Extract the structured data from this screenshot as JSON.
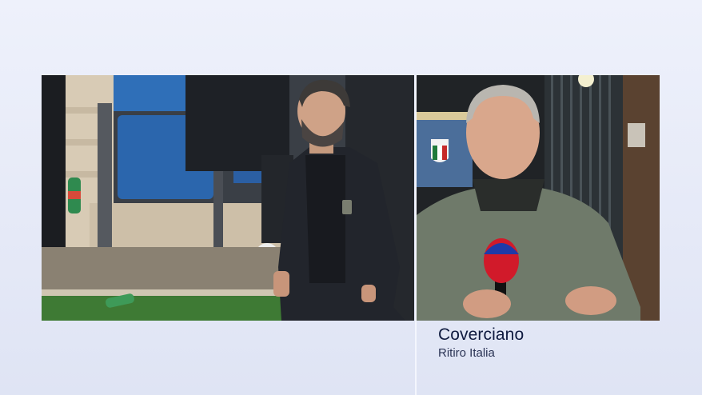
{
  "caption": {
    "location": "Coverciano",
    "subtitle": "Ritiro Italia"
  },
  "video_feeds": {
    "left": "coach-on-sideline",
    "right": "reporter-live"
  },
  "colors": {
    "background": "#e5e9f7",
    "caption_title": "#0f1a3f",
    "caption_subtitle": "#2a3354",
    "microphone_red": "#d11a2a",
    "microphone_blue": "#1f3aa8"
  }
}
